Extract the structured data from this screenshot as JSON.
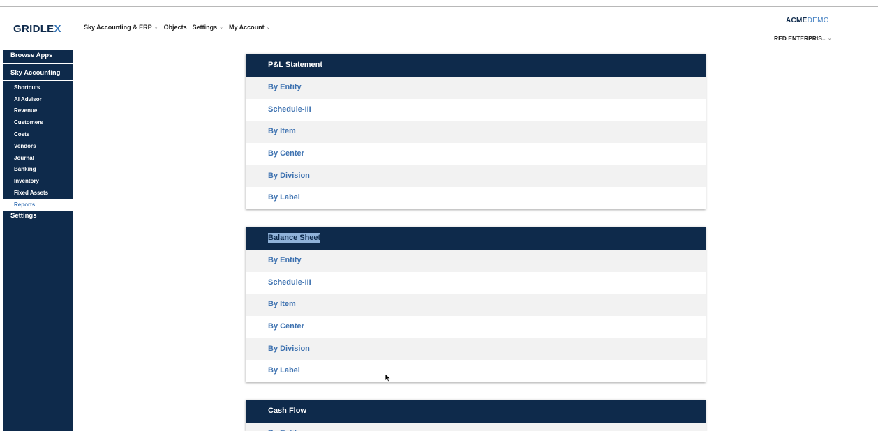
{
  "header": {
    "logo_main": "GRIDLE",
    "logo_x": "X",
    "nav": [
      {
        "label": "Sky Accounting & ERP",
        "dropdown": true
      },
      {
        "label": "Objects",
        "dropdown": false
      },
      {
        "label": "Settings",
        "dropdown": true
      },
      {
        "label": "My Account",
        "dropdown": true
      }
    ],
    "brand_a": "ACME",
    "brand_b": "DEMO",
    "org": "RED ENTERPRIS.."
  },
  "sidebar": {
    "browse": "Browse Apps",
    "app": "Sky Accounting",
    "items": [
      {
        "label": "Shortcuts"
      },
      {
        "label": "AI Advisor"
      },
      {
        "label": "Revenue"
      },
      {
        "label": "Customers"
      },
      {
        "label": "Costs"
      },
      {
        "label": "Vendors"
      },
      {
        "label": "Journal"
      },
      {
        "label": "Banking"
      },
      {
        "label": "Inventory"
      },
      {
        "label": "Fixed Assets"
      },
      {
        "label": "Reports",
        "active": true
      }
    ],
    "settings": "Settings"
  },
  "reports": [
    {
      "title": "P&L Statement",
      "rows": [
        "By Entity",
        "Schedule-III",
        "By Item",
        "By Center",
        "By Division",
        "By Label"
      ]
    },
    {
      "title": "Balance Sheet",
      "selected": true,
      "rows": [
        "By Entity",
        "Schedule-III",
        "By Item",
        "By Center",
        "By Division",
        "By Label"
      ]
    },
    {
      "title": "Cash Flow",
      "rows": [
        "By Entity"
      ]
    }
  ],
  "colors": {
    "navy": "#0e2a4b",
    "link": "#3e72b0",
    "row_alt": "#f2f2f2",
    "selection": "#8fb2d9"
  }
}
